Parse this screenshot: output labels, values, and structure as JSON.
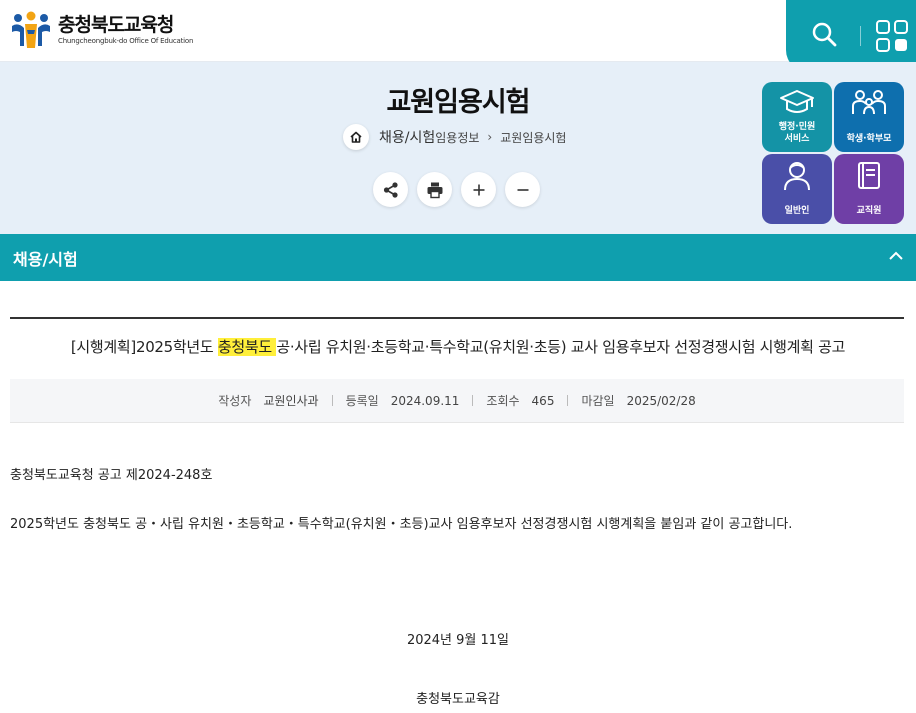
{
  "header": {
    "logo_ko": "충청북도교육청",
    "logo_en": "Chungcheongbuk-do Office Of Education"
  },
  "page": {
    "title": "교원임용시험",
    "breadcrumb": [
      "채용/시험",
      "임용정보",
      "교원임용시험"
    ]
  },
  "quick_menu": [
    {
      "label_line1": "행정·민원",
      "label_line2": "서비스",
      "icon": "graduation-cap-icon",
      "color": "#1493a6"
    },
    {
      "label_line1": "학생·학부모",
      "label_line2": "",
      "icon": "family-icon",
      "color": "#0e6fae"
    },
    {
      "label_line1": "일반인",
      "label_line2": "",
      "icon": "person-icon",
      "color": "#4a4fa8"
    },
    {
      "label_line1": "교직원",
      "label_line2": "",
      "icon": "book-icon",
      "color": "#6f3fa6"
    }
  ],
  "section": {
    "label": "채용/시험"
  },
  "article": {
    "title_prefix": "[시행계획]2025학년도 ",
    "title_highlight": "충청북도 ",
    "title_suffix": "공·사립 유치원·초등학교·특수학교(유치원·초등) 교사 임용후보자 선정경쟁시험 시행계획 공고",
    "meta": {
      "author_label": "작성자",
      "author": "교원인사과",
      "date_label": "등록일",
      "date": "2024.09.11",
      "views_label": "조회수",
      "views": "465",
      "deadline_label": "마감일",
      "deadline": "2025/02/28"
    },
    "notice_no": "충청북도교육청 공고 제2024-248호",
    "body": "2025학년도 충청북도 공・사립 유치원・초등학교・특수학교(유치원・초등)교사 임용후보자 선정경쟁시험 시행계획을 붙임과 같이 공고합니다.",
    "issue_date": "2024년 9월 11일",
    "signer": "충청북도교육감"
  },
  "colors": {
    "accent": "#0f9fae",
    "title_band": "#e6eff8",
    "highlight": "#ffef3a"
  }
}
